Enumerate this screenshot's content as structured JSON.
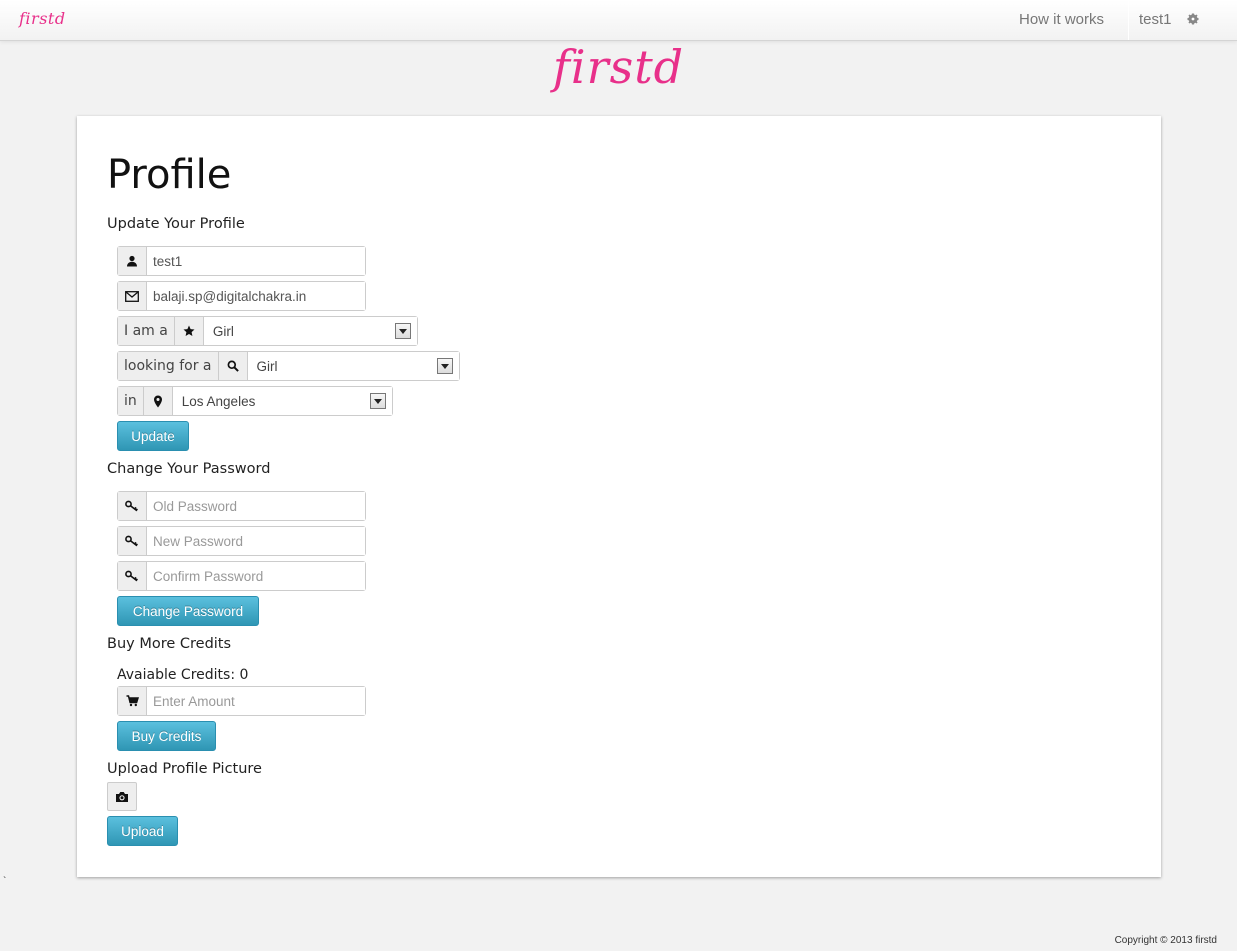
{
  "nav": {
    "brand": "firstd",
    "how_it_works": "How it works",
    "username": "test1",
    "settings_icon": "gear-icon"
  },
  "logo": "firstd",
  "profile": {
    "title": "Profile",
    "update_section": {
      "label": "Update Your Profile",
      "username": {
        "value": "test1",
        "icon": "user-icon"
      },
      "email": {
        "value": "balaji.sp@digitalchakra.in",
        "icon": "envelope-icon"
      },
      "i_am": {
        "label": "I am a",
        "icon": "star-icon",
        "value": "Girl"
      },
      "looking_for": {
        "label": "looking for a",
        "icon": "search-icon",
        "value": "Girl"
      },
      "location": {
        "label": "in",
        "icon": "map-marker-icon",
        "value": "Los Angeles"
      },
      "button": "Update"
    },
    "password_section": {
      "label": "Change Your Password",
      "old_placeholder": "Old Password",
      "new_placeholder": "New Password",
      "confirm_placeholder": "Confirm Password",
      "button": "Change Password"
    },
    "credits_section": {
      "label": "Buy More Credits",
      "available": "Avaiable Credits: 0",
      "amount_placeholder": "Enter Amount",
      "button": "Buy Credits"
    },
    "upload_section": {
      "label": "Upload Profile Picture",
      "button": "Upload"
    }
  },
  "stray_mark": "`",
  "footer": "Copyright © 2013 firstd"
}
